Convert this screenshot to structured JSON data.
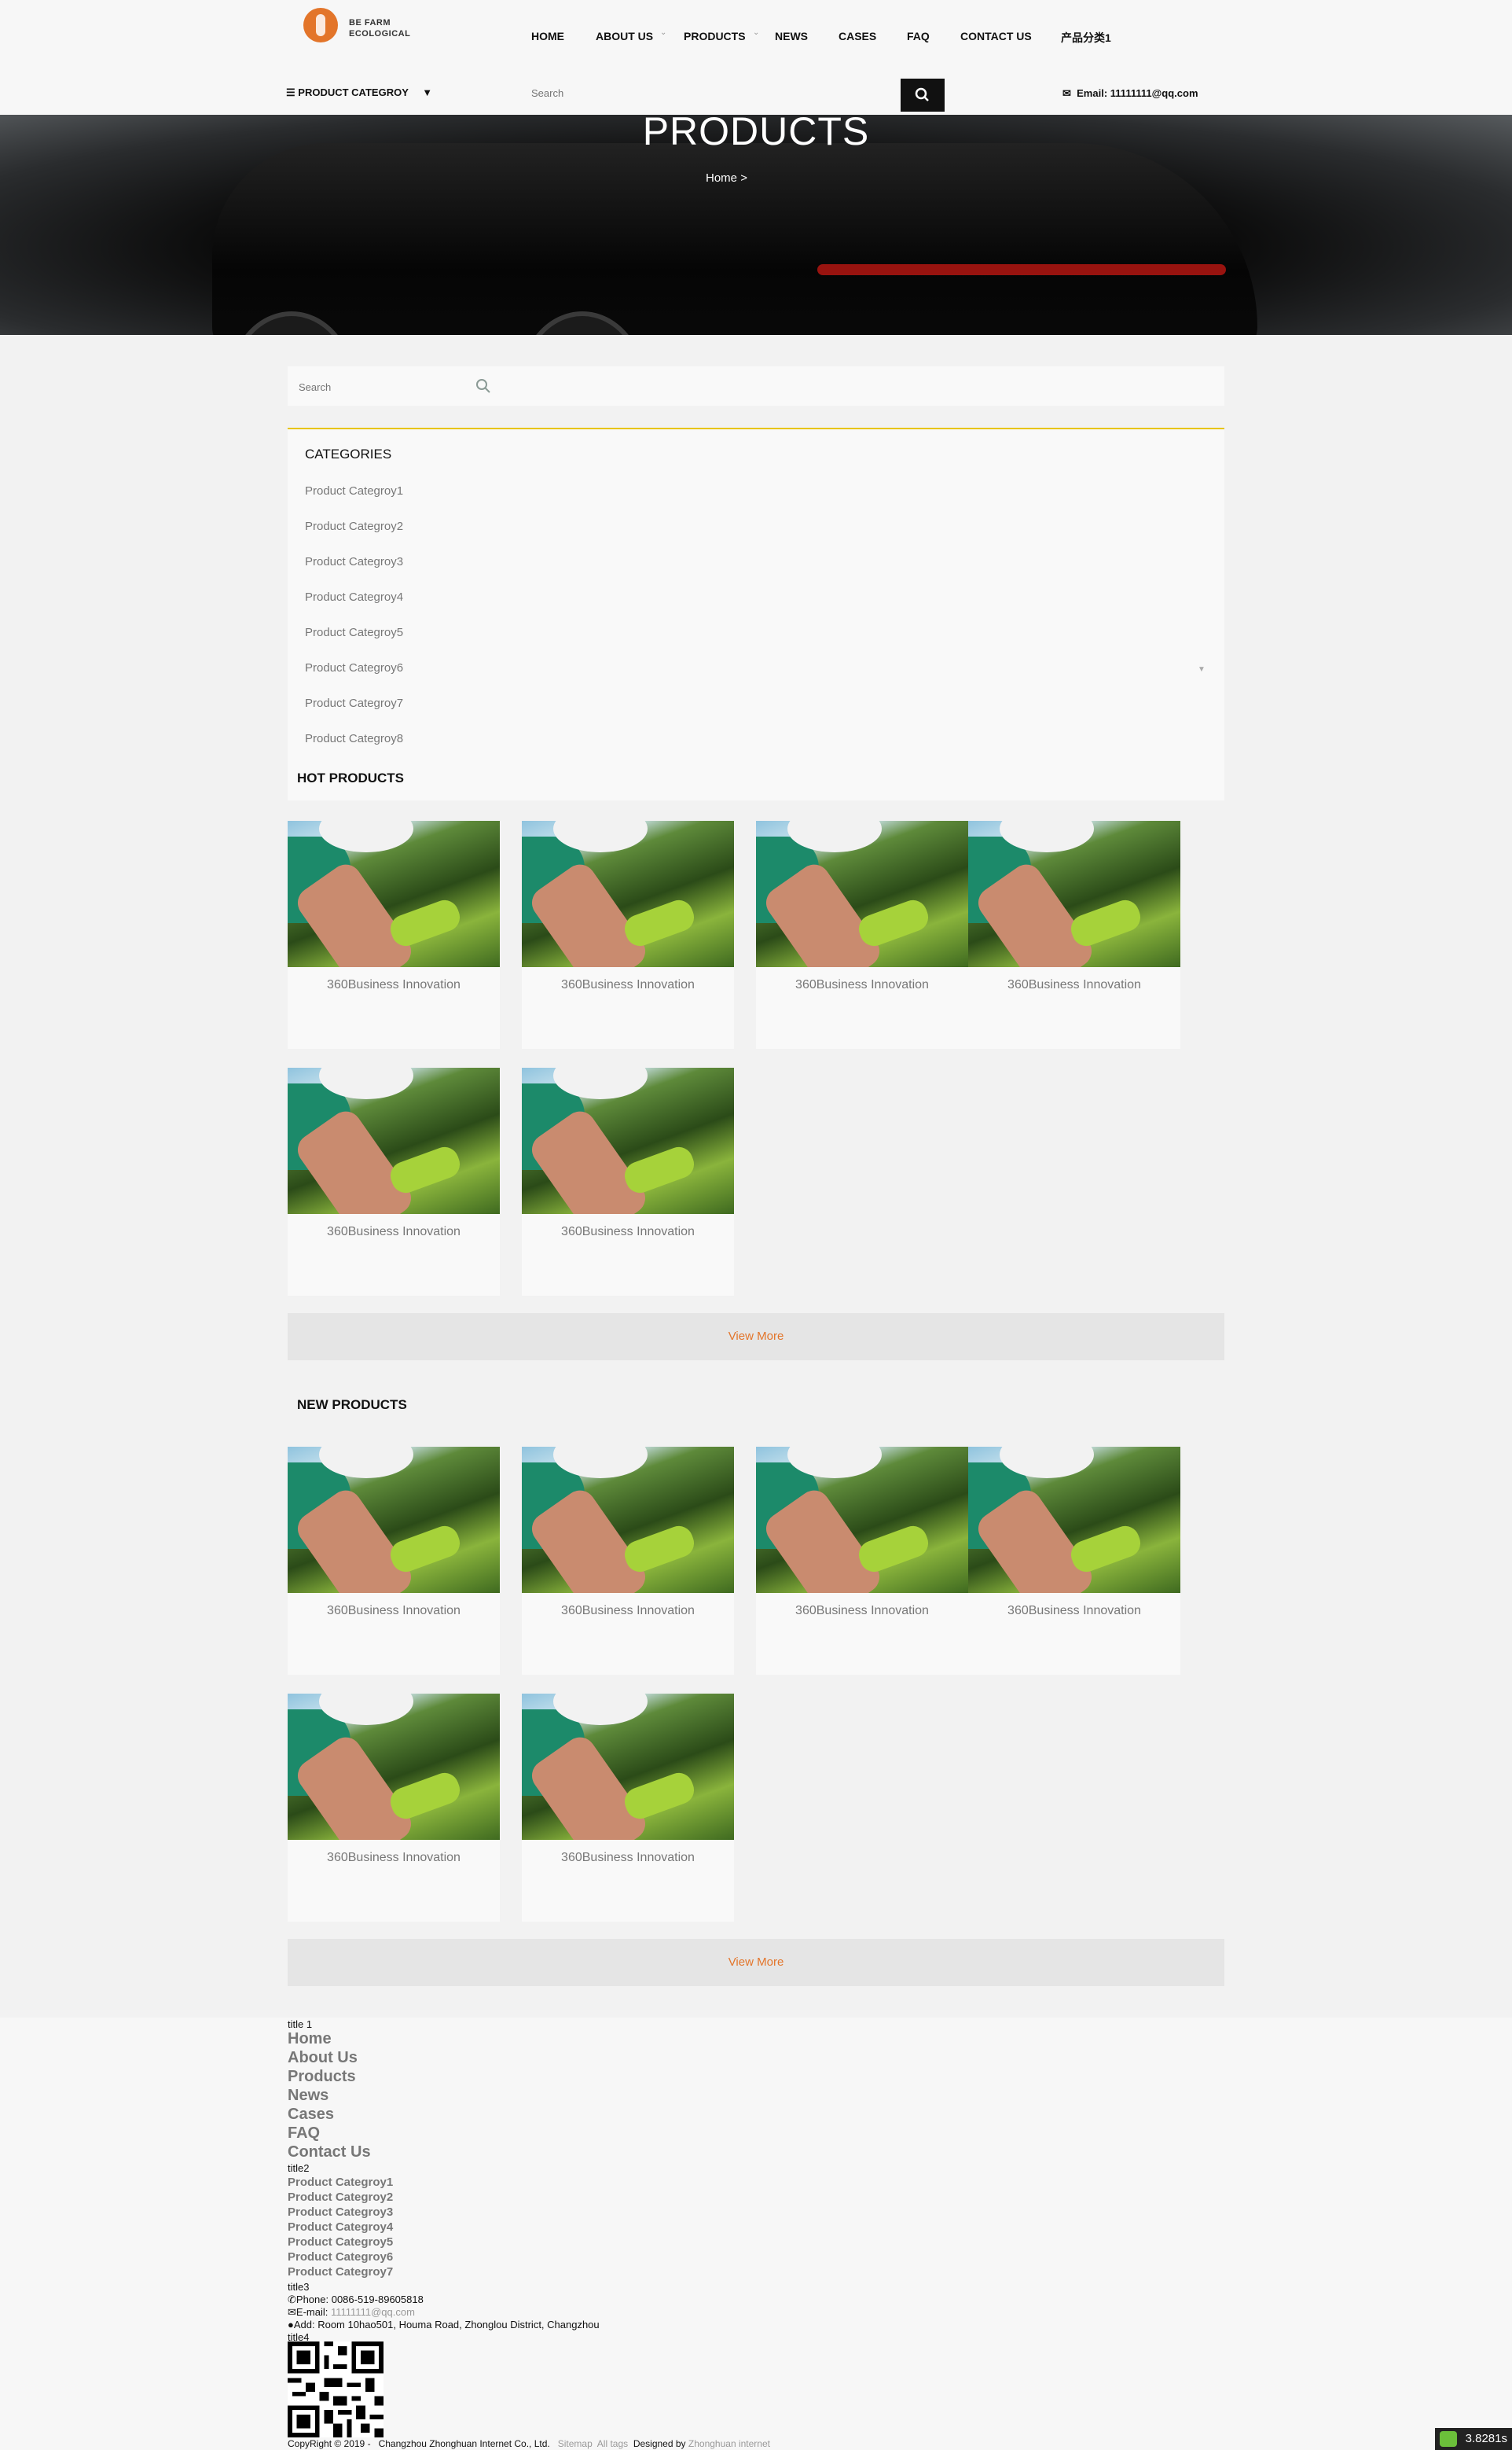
{
  "header": {
    "logo_line1": "BE FARM",
    "logo_line2": "ECOLOGICAL",
    "nav": [
      "HOME",
      "ABOUT US",
      "PRODUCTS",
      "NEWS",
      "CASES",
      "FAQ",
      "CONTACT US",
      "产品分类1"
    ],
    "product_category_label": "PRODUCT CATEGROY",
    "search_placeholder": "Search",
    "email_label": "Email:",
    "email_value": "11111111@qq.com"
  },
  "banner": {
    "title": "PRODUCTS",
    "breadcrumb_home": "Home",
    "breadcrumb_sep": ">"
  },
  "sidebar": {
    "search_placeholder": "Search",
    "categories_title": "CATEGORIES",
    "categories": [
      "Product Categroy1",
      "Product Categroy2",
      "Product Categroy3",
      "Product Categroy4",
      "Product Categroy5",
      "Product Categroy6",
      "Product Categroy7",
      "Product Categroy8"
    ]
  },
  "hot_products": {
    "title": "HOT PRODUCTS",
    "items": [
      "360Business Innovation",
      "360Business Innovation",
      "360Business Innovation",
      "360Business Innovation",
      "360Business Innovation",
      "360Business Innovation"
    ],
    "view_more": "View More"
  },
  "new_products": {
    "title": "NEW PRODUCTS",
    "items": [
      "360Business Innovation",
      "360Business Innovation",
      "360Business Innovation",
      "360Business Innovation",
      "360Business Innovation",
      "360Business Innovation"
    ],
    "view_more": "View More"
  },
  "footer": {
    "title1": "title 1",
    "links1": [
      "Home",
      "About Us",
      "Products",
      "News",
      "Cases",
      "FAQ",
      "Contact Us"
    ],
    "title2": "title2",
    "links2": [
      "Product Categroy1",
      "Product Categroy2",
      "Product Categroy3",
      "Product Categroy4",
      "Product Categroy5",
      "Product Categroy6",
      "Product Categroy7"
    ],
    "title3": "title3",
    "phone": "Phone: 0086-519-89605818",
    "email_label": "E-mail:",
    "email_value": "11111111@qq.com",
    "address": "Add: Room 10hao501, Houma Road, Zhonglou District, Changzhou",
    "title4": "title4",
    "copyright": "CopyRight © 2019 -",
    "company": "Changzhou Zhonghuan Internet Co., Ltd.",
    "sitemap": "Sitemap",
    "all_tags": "All tags",
    "designed_by": "Designed by",
    "designer": "Zhonghuan internet"
  },
  "timer_badge": "3.8281s",
  "colors": {
    "accent": "#e3752a",
    "category_border": "#e8c400",
    "dark": "#111111"
  }
}
